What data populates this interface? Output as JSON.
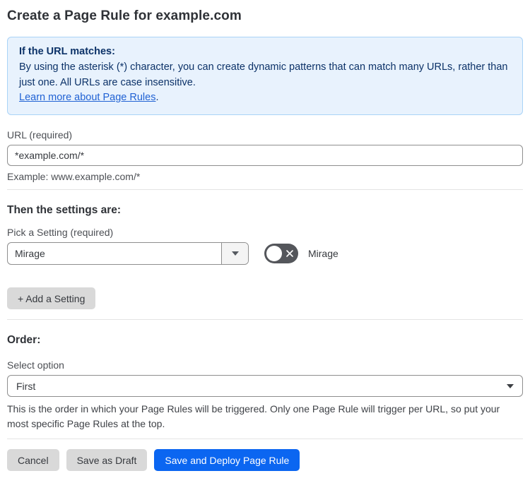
{
  "page": {
    "title": "Create a Page Rule for example.com"
  },
  "info_box": {
    "heading": "If the URL matches:",
    "body": "By using the asterisk (*) character, you can create dynamic patterns that can match many URLs, rather than just one. All URLs are case insensitive.",
    "link_label": "Learn more about Page Rules",
    "link_suffix": "."
  },
  "url_section": {
    "label": "URL (required)",
    "value": "*example.com/*",
    "example": "Example: www.example.com/*"
  },
  "settings_section": {
    "heading": "Then the settings are:",
    "picker_label": "Pick a Setting (required)",
    "selected_setting": "Mirage",
    "toggle_label": "Mirage",
    "toggle_state": "off",
    "toggle_icon": "close-x",
    "add_button_label": "+ Add a Setting"
  },
  "order_section": {
    "heading": "Order:",
    "label": "Select option",
    "selected_option": "First",
    "help_text": "This is the order in which your Page Rules will be triggered. Only one Page Rule will trigger per URL, so put your most specific Page Rules at the top."
  },
  "footer": {
    "cancel_label": "Cancel",
    "save_draft_label": "Save as Draft",
    "save_deploy_label": "Save and Deploy Page Rule"
  },
  "colors": {
    "info_bg": "#e8f2fd",
    "info_border": "#a9d3f7",
    "info_text": "#0c3268",
    "link_blue": "#2062d4",
    "primary_button_blue": "#0b66f1",
    "secondary_button_gray": "#d9d9d9",
    "toggle_off_bg": "#54565b"
  }
}
